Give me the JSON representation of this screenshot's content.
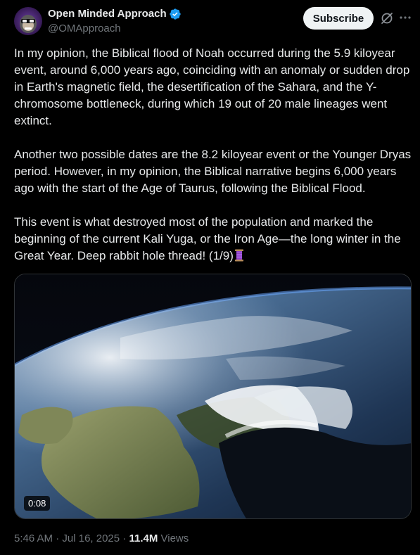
{
  "author": {
    "name": "Open Minded Approach",
    "handle": "@OMApproach",
    "verified_color": "#1d9bf0"
  },
  "header": {
    "subscribe_label": "Subscribe",
    "icons": [
      "grok-icon",
      "more-icon"
    ]
  },
  "tweet": {
    "paragraphs": [
      "In my opinion, the Biblical flood of Noah occurred during the 5.9 kiloyear event, around 6,000 years ago, coinciding with an anomaly or sudden drop in Earth's magnetic field, the desertification of the Sahara, and the Y-chromosome bottleneck, during which 19 out of 20 male lineages went extinct.",
      "Another two possible dates are the 8.2 kiloyear event or the Younger Dryas period. However, in my opinion, the Biblical narrative begins 6,000 years ago with the start of the Age of Taurus, following the Biblical Flood.",
      "This event is what destroyed most of the population and marked the beginning of the current Kali Yuga, or the Iron Age—the long winter in the Great Year. Deep rabbit hole thread! (1/9)"
    ],
    "thread_emoji": "spool-of-thread-icon"
  },
  "media": {
    "duration": "0:08"
  },
  "meta": {
    "time": "5:46 AM",
    "separator": " · ",
    "date": "Jul 16, 2025",
    "views_count": "11.4M",
    "views_label": "Views"
  },
  "colors": {
    "background": "#000000",
    "text": "#e7e9ea",
    "secondary": "#71767b",
    "subscribe_bg": "#eff3f4"
  }
}
